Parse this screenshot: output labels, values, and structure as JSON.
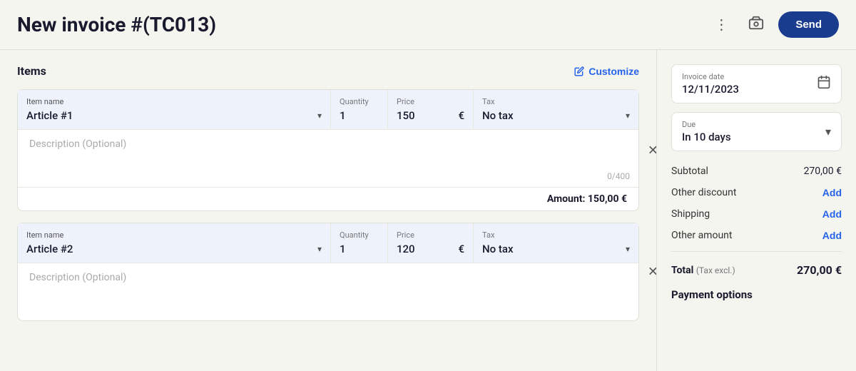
{
  "header": {
    "title": "New invoice #(TC013)",
    "send_label": "Send"
  },
  "items_section": {
    "title": "Items",
    "customize_label": "Customize"
  },
  "item1": {
    "item_name_label": "Item name",
    "item_name_value": "Article #1",
    "quantity_label": "Quantity",
    "quantity_value": "1",
    "price_label": "Price",
    "price_value": "150",
    "price_currency": "€",
    "tax_label": "Tax",
    "tax_value": "No tax",
    "description_placeholder": "Description (Optional)",
    "char_count": "0/400",
    "amount_label": "Amount: 150,00 €"
  },
  "item2": {
    "item_name_label": "Item name",
    "item_name_value": "Article #2",
    "quantity_label": "Quantity",
    "quantity_value": "1",
    "price_label": "Price",
    "price_value": "120",
    "price_currency": "€",
    "tax_label": "Tax",
    "tax_value": "No tax",
    "description_placeholder": "Description (Optional)"
  },
  "sidebar": {
    "invoice_date_label": "Invoice date",
    "invoice_date_value": "12/11/2023",
    "due_label": "Due",
    "due_value": "In 10 days",
    "subtotal_label": "Subtotal",
    "subtotal_value": "270,00 €",
    "other_discount_label": "Other discount",
    "other_discount_action": "Add",
    "shipping_label": "Shipping",
    "shipping_action": "Add",
    "other_amount_label": "Other amount",
    "other_amount_action": "Add",
    "total_label": "Total",
    "total_tax_label": "(Tax excl.)",
    "total_value": "270,00 €",
    "payment_options_label": "Payment options"
  }
}
